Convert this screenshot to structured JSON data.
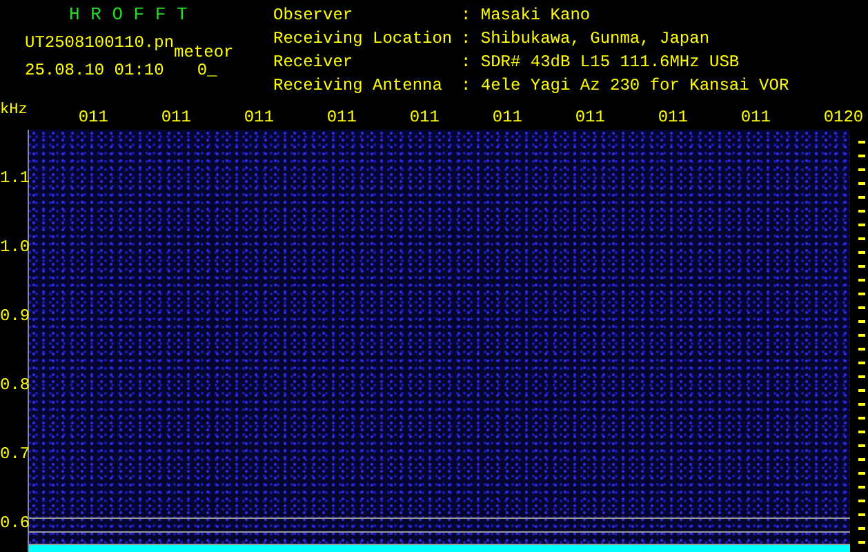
{
  "app_title": "H R O F F T",
  "file_name": "UT2508100110.pn",
  "tag": "meteor",
  "timestamp": "25.08.10 01:10",
  "count": "0_",
  "info": [
    {
      "label": "Observer",
      "value": ": Masaki Kano"
    },
    {
      "label": "Receiving Location",
      "value": ": Shibukawa, Gunma, Japan"
    },
    {
      "label": "Receiver",
      "value": ": SDR# 43dB L15 111.6MHz USB"
    },
    {
      "label": "Receiving Antenna",
      "value": ": 4ele Yagi Az 230 for Kansai VOR"
    }
  ],
  "spectrogram": {
    "unit": "kHz",
    "time_labels": [
      "011",
      "011",
      "011",
      "011",
      "011",
      "011",
      "011",
      "011",
      "011",
      "0120"
    ],
    "frequency_labels": [
      "1.1",
      "1.0",
      "0.9",
      "0.8",
      "0.7",
      "0.6"
    ]
  }
}
